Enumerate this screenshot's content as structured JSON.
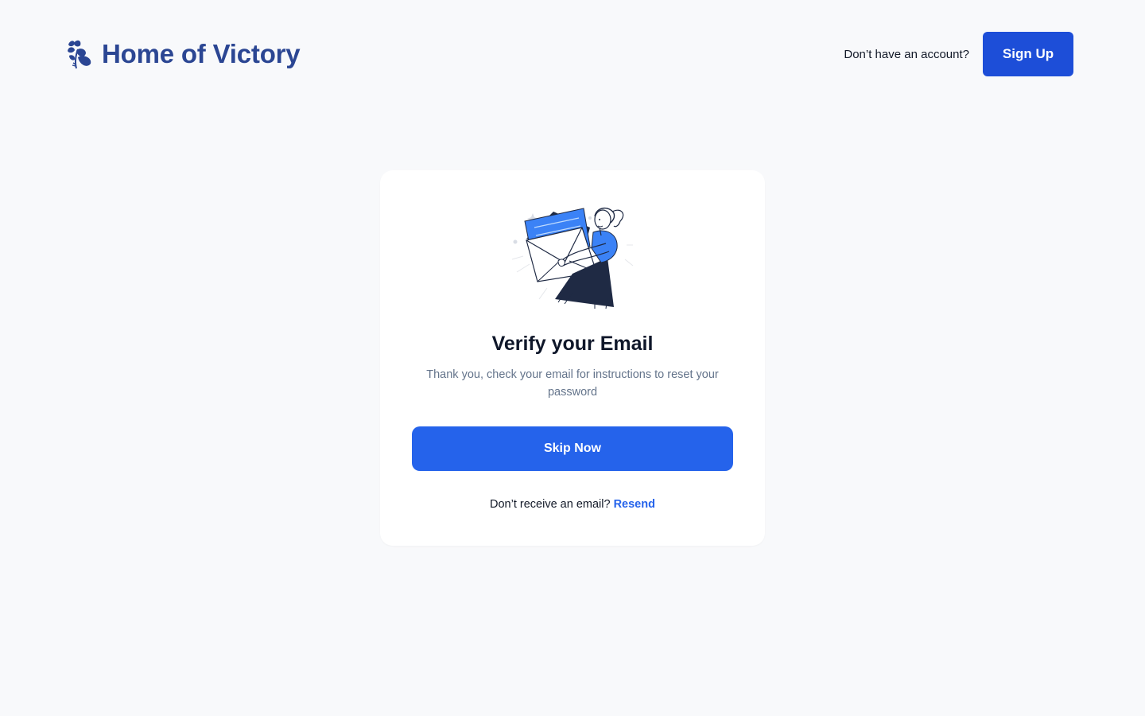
{
  "header": {
    "brand_name": "Home of Victory",
    "logo_icon": "laurel-leaf-icon",
    "prompt": "Don’t have an account?",
    "signup_label": "Sign Up"
  },
  "card": {
    "illustration": "woman-holding-envelope-illustration",
    "title": "Verify your Email",
    "message": "Thank you, check your email for instructions to reset your password",
    "skip_label": "Skip Now",
    "resend_prompt": "Don’t receive an email?",
    "resend_label": "Resend"
  },
  "colors": {
    "brand": "#2b4693",
    "primary": "#2563eb",
    "signup": "#1d4ed8",
    "background": "#f8f9fb",
    "muted_text": "#64748b"
  }
}
